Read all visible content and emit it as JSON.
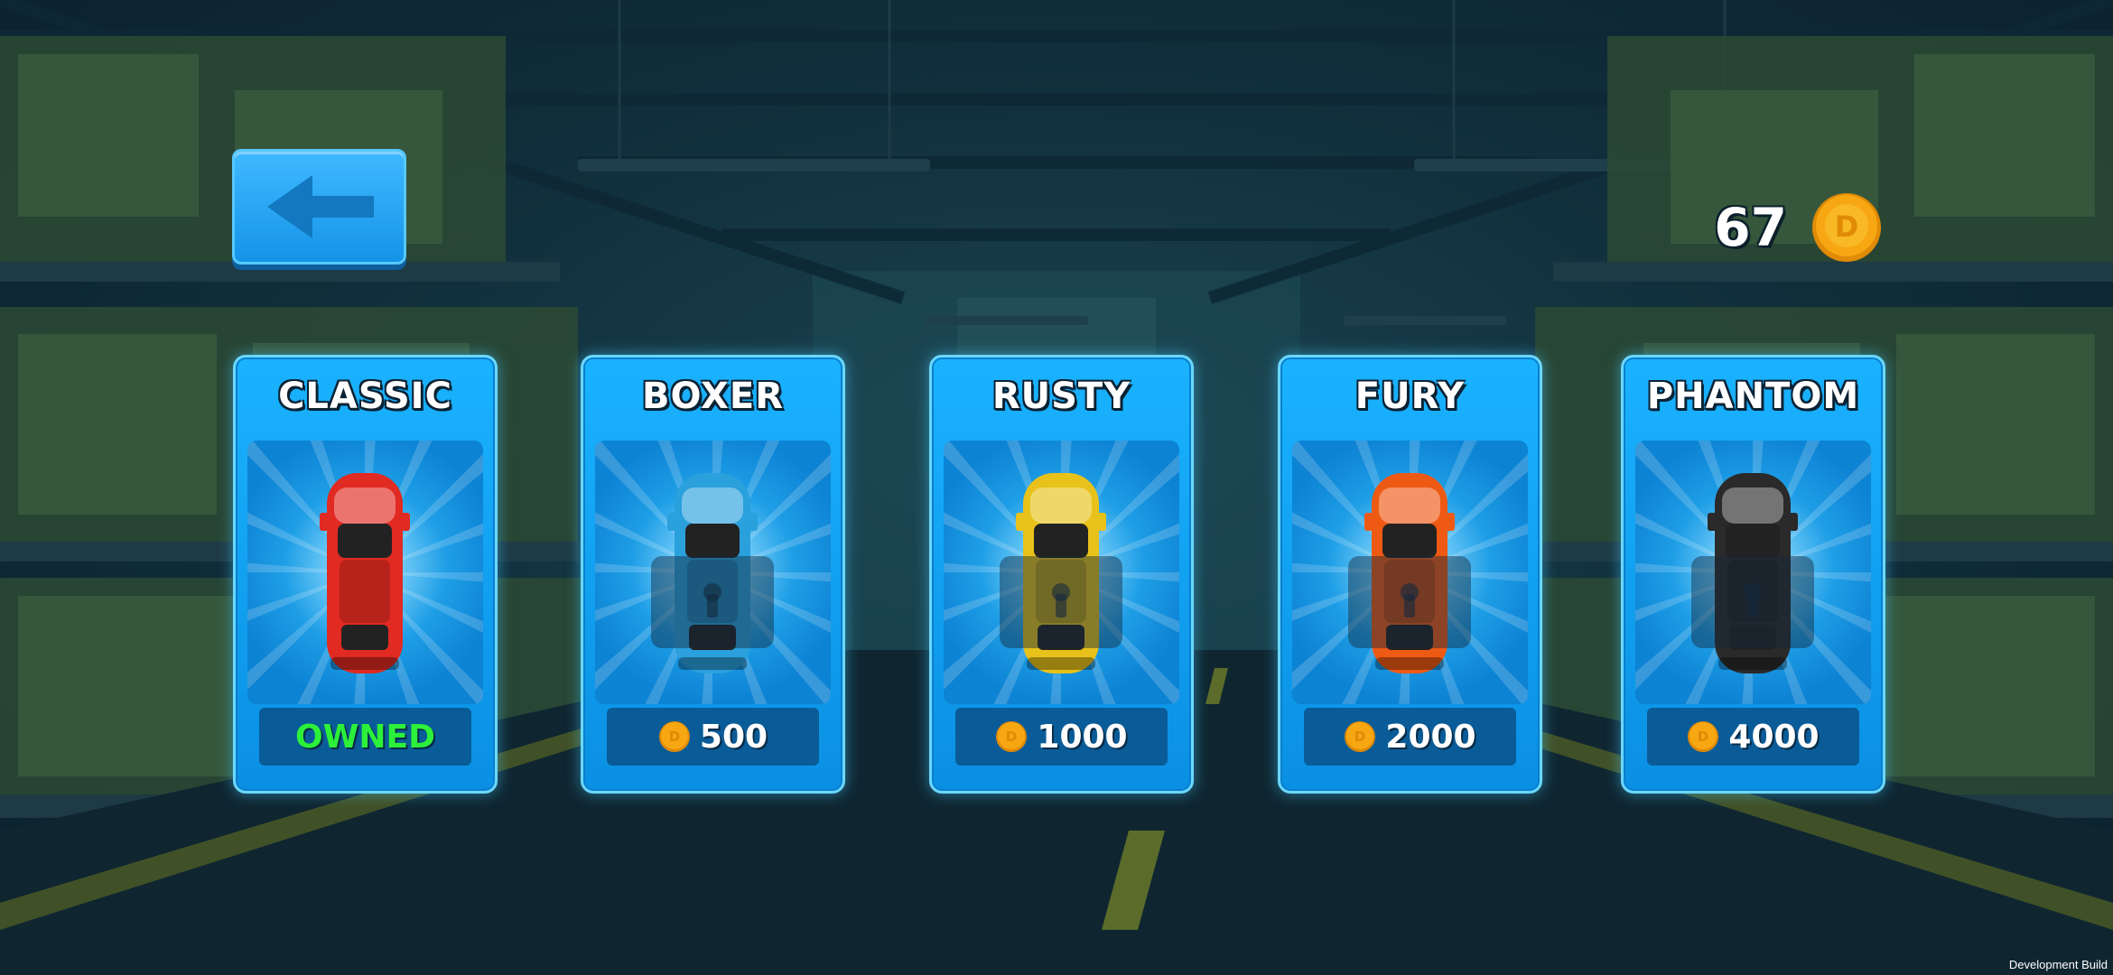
{
  "hud": {
    "coin_balance": "67",
    "coin_icon": "coin-icon"
  },
  "back_button": {
    "icon": "arrow-left-icon"
  },
  "cars": [
    {
      "name": "CLASSIC",
      "status": "OWNED",
      "color": "#e02a22",
      "locked": false
    },
    {
      "name": "BOXER",
      "price": "500",
      "color": "#2aa0dd",
      "locked": true
    },
    {
      "name": "RUSTY",
      "price": "1000",
      "color": "#e8c21a",
      "locked": true
    },
    {
      "name": "FURY",
      "price": "2000",
      "color": "#ee5a14",
      "locked": true
    },
    {
      "name": "PHANTOM",
      "price": "4000",
      "color": "#2a2a2a",
      "locked": true
    }
  ],
  "footer": {
    "build_label": "Development Build"
  },
  "colors": {
    "accent": "#1593e8",
    "owned": "#2cf03a",
    "coin": "#f7a712"
  }
}
